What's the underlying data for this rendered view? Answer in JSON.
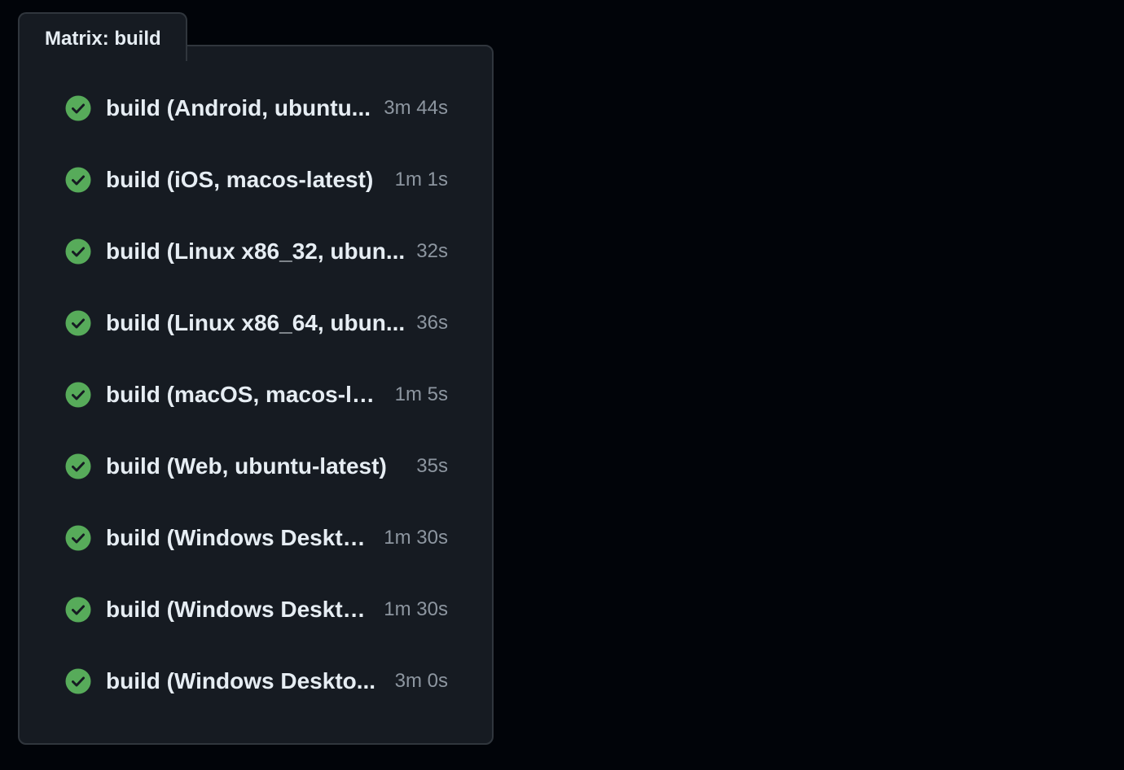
{
  "matrix": {
    "title": "Matrix: build",
    "jobs": [
      {
        "name": "build (Android, ubuntu...",
        "duration": "3m 44s",
        "status": "success"
      },
      {
        "name": "build (iOS, macos-latest)",
        "duration": "1m 1s",
        "status": "success"
      },
      {
        "name": "build (Linux x86_32, ubun...",
        "duration": "32s",
        "status": "success"
      },
      {
        "name": "build (Linux x86_64, ubun...",
        "duration": "36s",
        "status": "success"
      },
      {
        "name": "build (macOS, macos-la...",
        "duration": "1m 5s",
        "status": "success"
      },
      {
        "name": "build (Web, ubuntu-latest)",
        "duration": "35s",
        "status": "success"
      },
      {
        "name": "build (Windows Deskto...",
        "duration": "1m 30s",
        "status": "success"
      },
      {
        "name": "build (Windows Deskto...",
        "duration": "1m 30s",
        "status": "success"
      },
      {
        "name": "build (Windows Deskto...",
        "duration": "3m 0s",
        "status": "success"
      }
    ]
  },
  "icons": {
    "status": "check-circle-fill-icon"
  },
  "colors": {
    "success": "#57ab5a",
    "page_background": "#010409",
    "panel_background": "#161b22",
    "border": "#30363d",
    "text_primary": "#e6edf3",
    "text_muted": "#8d96a0"
  }
}
